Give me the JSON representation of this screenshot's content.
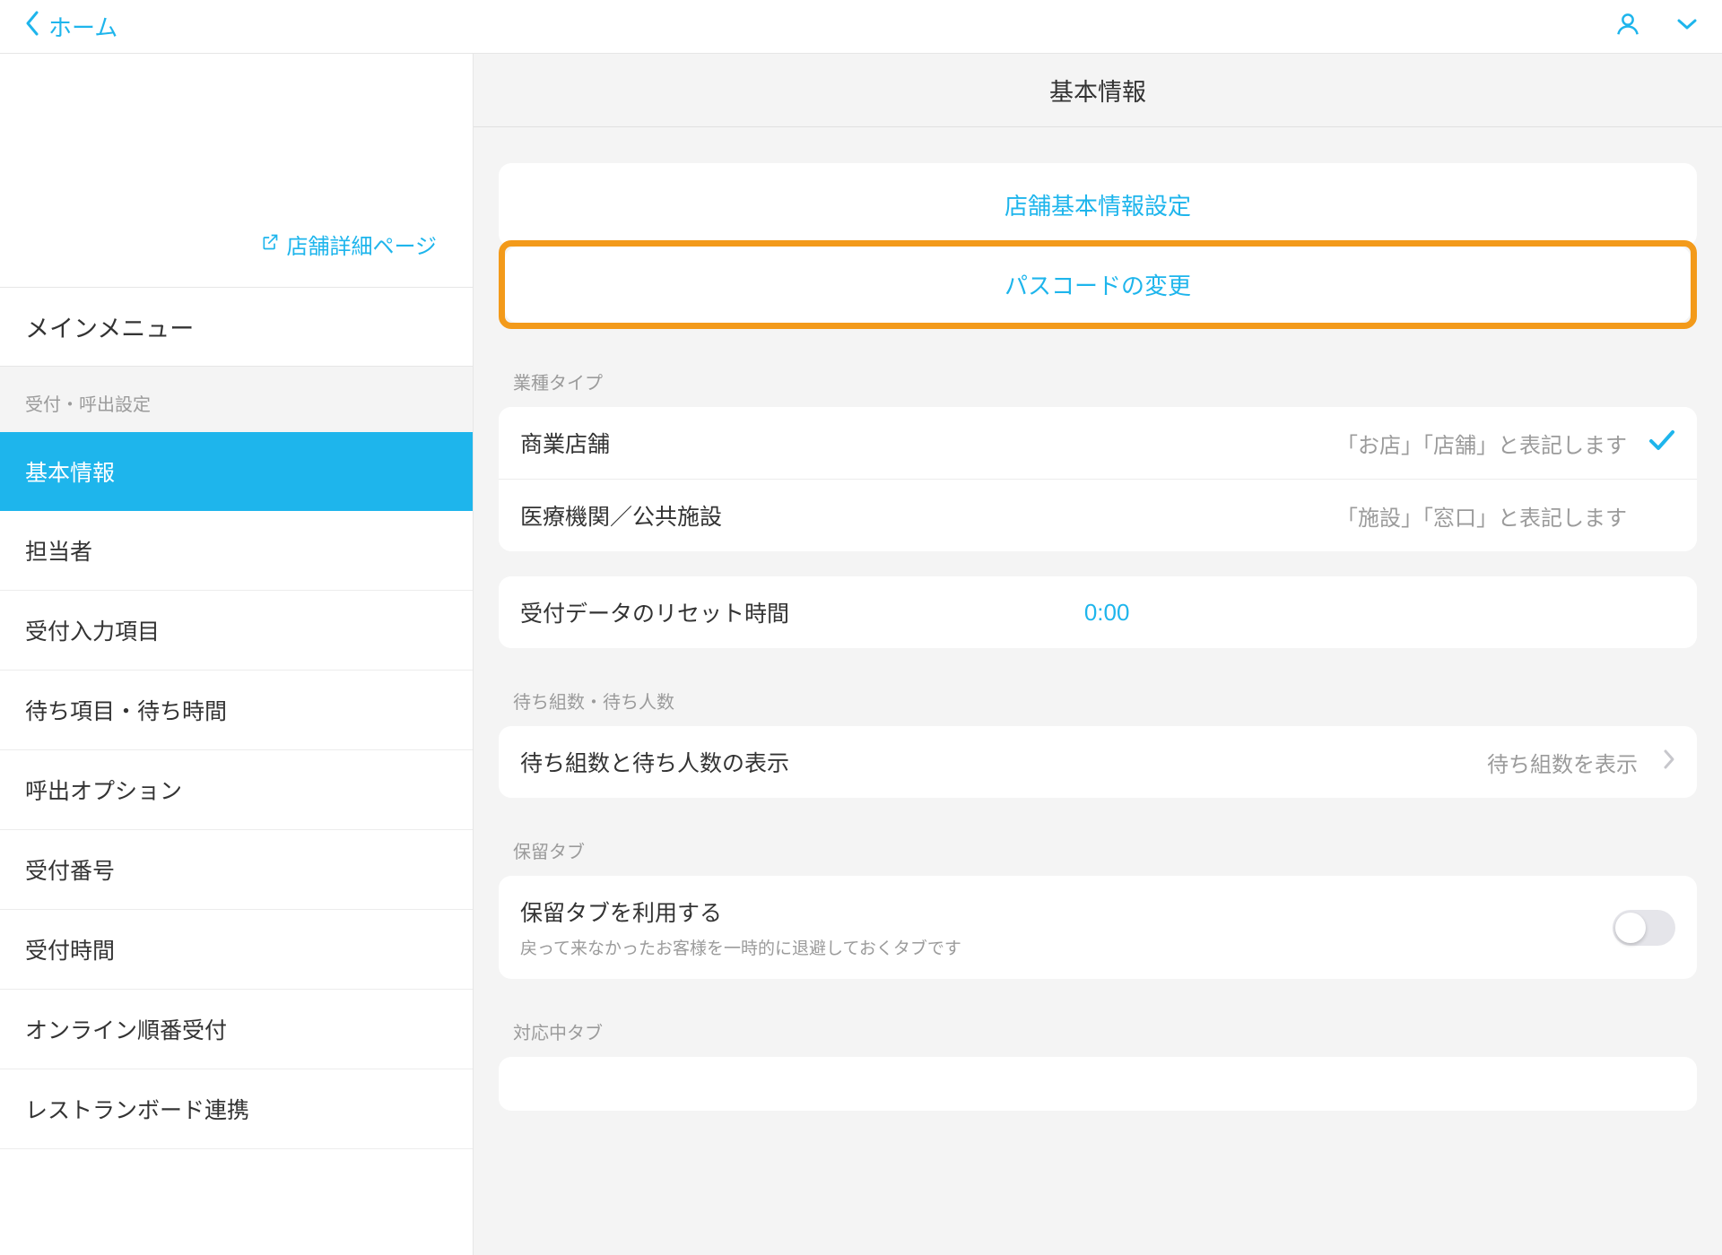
{
  "header": {
    "back_label": "ホーム"
  },
  "sidebar": {
    "ext_link": "店舗詳細ページ",
    "main_menu": "メインメニュー",
    "group_label": "受付・呼出設定",
    "items": [
      "基本情報",
      "担当者",
      "受付入力項目",
      "待ち項目・待ち時間",
      "呼出オプション",
      "受付番号",
      "受付時間",
      "オンライン順番受付",
      "レストランボード連携"
    ]
  },
  "main": {
    "title": "基本情報",
    "link1": "店舗基本情報設定",
    "link2": "パスコードの変更",
    "business_type_label": "業種タイプ",
    "bt_row1_label": "商業店舗",
    "bt_row1_desc": "「お店」「店舗」と表記します",
    "bt_row2_label": "医療機関／公共施設",
    "bt_row2_desc": "「施設」「窓口」と表記します",
    "reset_label": "受付データのリセット時間",
    "reset_value": "0:00",
    "wait_section_label": "待ち組数・待ち人数",
    "wait_row_label": "待ち組数と待ち人数の表示",
    "wait_row_value": "待ち組数を表示",
    "hold_section_label": "保留タブ",
    "hold_row_label": "保留タブを利用する",
    "hold_row_sub": "戻って来なかったお客様を一時的に退避しておくタブです",
    "serving_section_label": "対応中タブ"
  }
}
